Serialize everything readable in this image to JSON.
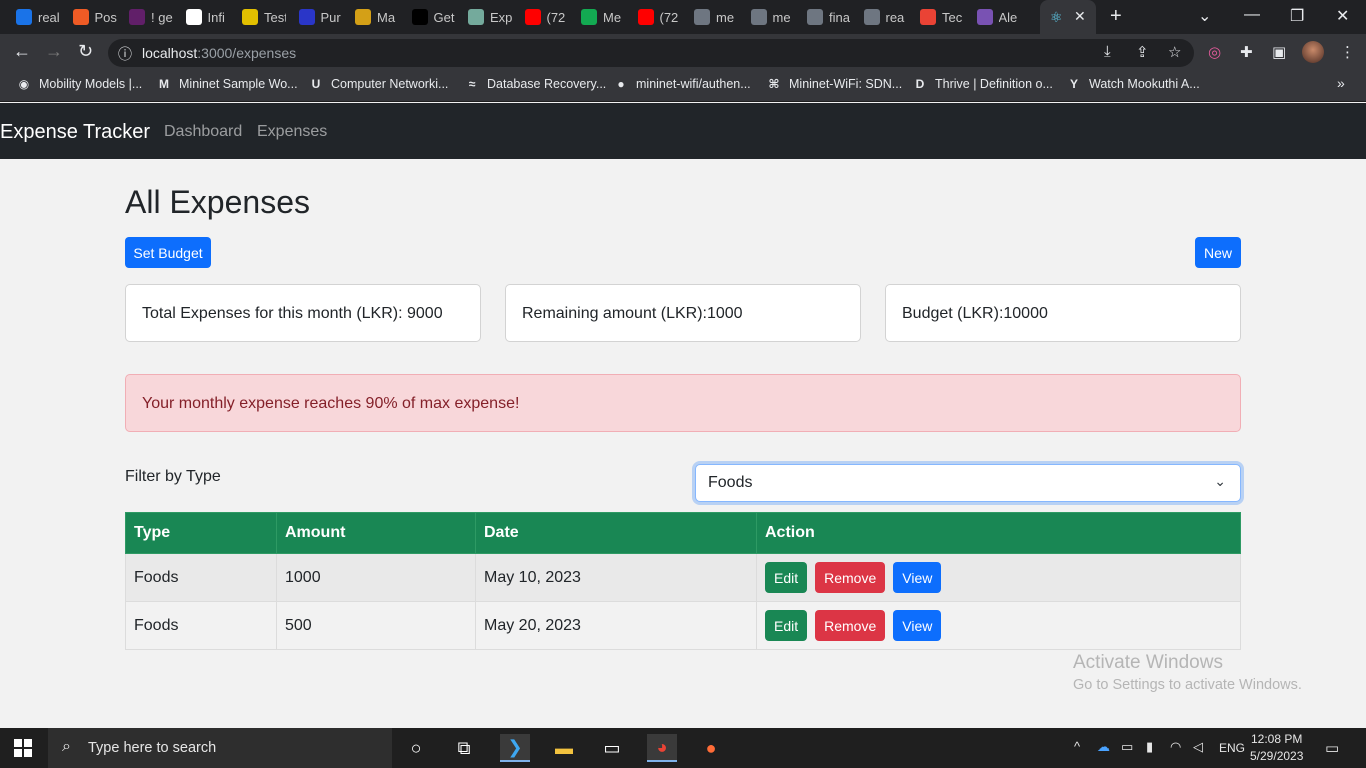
{
  "browser": {
    "tabs": [
      {
        "title": "real",
        "color": "#1a73e8"
      },
      {
        "title": "Pos",
        "color": "#ef5b25"
      },
      {
        "title": "! ge",
        "color": "#611f69"
      },
      {
        "title": "Infi",
        "color": "#ffffff"
      },
      {
        "title": "Test",
        "color": "#e2c000"
      },
      {
        "title": "Pur",
        "color": "#2a36c8"
      },
      {
        "title": "Ma",
        "color": "#d4a017"
      },
      {
        "title": "Get",
        "color": "#000000"
      },
      {
        "title": "Exp",
        "color": "#74aa9c"
      },
      {
        "title": "(72",
        "color": "#ff0000"
      },
      {
        "title": "Me",
        "color": "#13aa52"
      },
      {
        "title": "(72",
        "color": "#ff0000"
      },
      {
        "title": "me",
        "color": "#6e7681"
      },
      {
        "title": "me",
        "color": "#6e7681"
      },
      {
        "title": "fina",
        "color": "#6e7681"
      },
      {
        "title": "rea",
        "color": "#6e7681"
      },
      {
        "title": "Tec",
        "color": "#ea4335"
      },
      {
        "title": "Ale",
        "color": "#7952b3"
      }
    ],
    "url_host": "localhost",
    "url_path": ":3000/expenses",
    "bookmarks": [
      {
        "label": "Mobility Models |...",
        "icon": "◉"
      },
      {
        "label": "Mininet Sample Wo...",
        "icon": "M"
      },
      {
        "label": "Computer Networki...",
        "icon": "U"
      },
      {
        "label": "Database Recovery...",
        "icon": "≈"
      },
      {
        "label": "mininet-wifi/authen...",
        "icon": "●"
      },
      {
        "label": "Mininet-WiFi: SDN...",
        "icon": "⌘"
      },
      {
        "label": "Thrive | Definition o...",
        "icon": "D"
      },
      {
        "label": "Watch Mookuthi A...",
        "icon": "Y"
      }
    ]
  },
  "app": {
    "brand": "Expense Tracker",
    "nav": [
      "Dashboard",
      "Expenses"
    ],
    "title": "All Expenses",
    "set_budget_label": "Set Budget",
    "new_label": "New",
    "cards": [
      "Total Expenses for this month (LKR): 9000",
      "Remaining amount (LKR):1000",
      "Budget (LKR):10000"
    ],
    "alert": "Your monthly expense reaches 90% of max expense!",
    "filter_label": "Filter by Type",
    "filter_value": "Foods",
    "table": {
      "headers": [
        "Type",
        "Amount",
        "Date",
        "Action"
      ],
      "rows": [
        {
          "type": "Foods",
          "amount": "1000",
          "date": "May 10, 2023"
        },
        {
          "type": "Foods",
          "amount": "500",
          "date": "May 20, 2023"
        }
      ],
      "action_labels": {
        "edit": "Edit",
        "remove": "Remove",
        "view": "View"
      }
    }
  },
  "watermark": {
    "line1": "Activate Windows",
    "line2": "Go to Settings to activate Windows."
  },
  "taskbar": {
    "search_placeholder": "Type here to search",
    "lang": "ENG",
    "time": "12:08 PM",
    "date": "5/29/2023"
  }
}
